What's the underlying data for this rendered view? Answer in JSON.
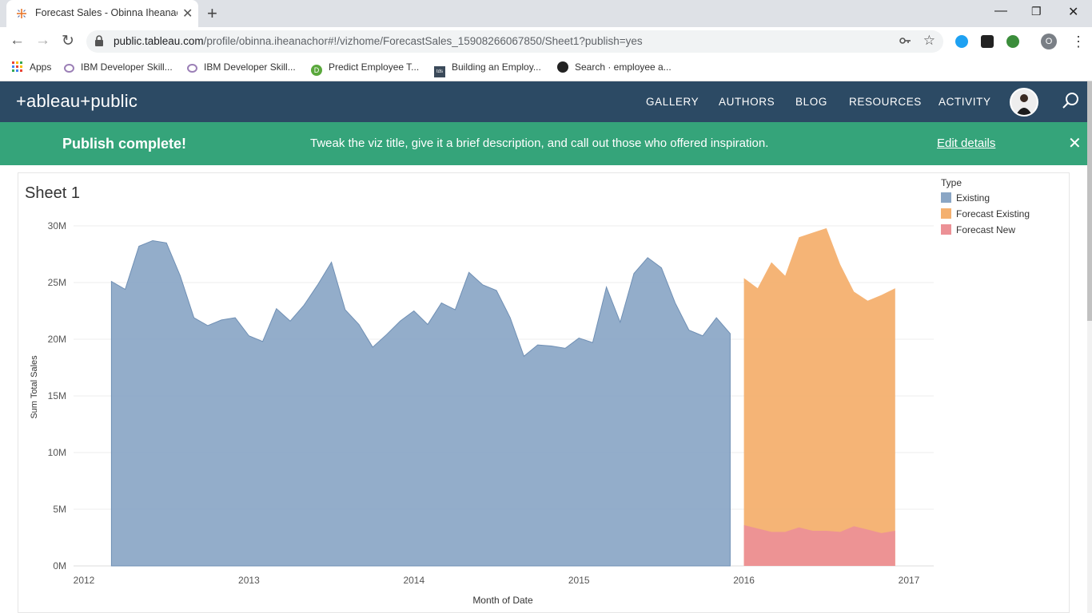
{
  "browser": {
    "tab_title": "Forecast Sales - Obinna Iheanach",
    "url_host": "public.tableau.com",
    "url_path": "/profile/obinna.iheanachor#!/vizhome/ForecastSales_15908266067850/Sheet1?publish=yes",
    "profile_initial": "O"
  },
  "bookmarks": [
    {
      "label": "Apps"
    },
    {
      "label": "IBM Developer Skill..."
    },
    {
      "label": "IBM Developer Skill..."
    },
    {
      "label": "Predict Employee T..."
    },
    {
      "label": "Building an Employ..."
    },
    {
      "label": "Search · employee a..."
    }
  ],
  "header": {
    "logo": "+ableau+public",
    "nav": [
      "GALLERY",
      "AUTHORS",
      "BLOG",
      "RESOURCES",
      "ACTIVITY"
    ]
  },
  "banner": {
    "title": "Publish complete!",
    "message": "Tweak the viz title, give it a brief description, and call out those who offered inspiration.",
    "edit_link": "Edit details"
  },
  "sheet": {
    "title": "Sheet 1"
  },
  "legend": {
    "title": "Type",
    "items": [
      {
        "label": "Existing",
        "color": "#8aa6c5"
      },
      {
        "label": "Forecast Existing",
        "color": "#f4b06f"
      },
      {
        "label": "Forecast New",
        "color": "#ec9196"
      }
    ]
  },
  "chart_data": {
    "type": "area",
    "xlabel": "Month of Date",
    "ylabel": "Sum Total Sales",
    "ylim": [
      0,
      30
    ],
    "y_unit": "M",
    "y_ticks": [
      "0M",
      "5M",
      "10M",
      "15M",
      "20M",
      "25M",
      "30M"
    ],
    "x_ticks": [
      "2012",
      "2013",
      "2014",
      "2015",
      "2016",
      "2017"
    ],
    "grid": true,
    "series": [
      {
        "name": "Existing",
        "color": "#8aa6c5",
        "x": [
          "2012-03",
          "2012-04",
          "2012-05",
          "2012-06",
          "2012-07",
          "2012-08",
          "2012-09",
          "2012-10",
          "2012-11",
          "2012-12",
          "2013-01",
          "2013-02",
          "2013-03",
          "2013-04",
          "2013-05",
          "2013-06",
          "2013-07",
          "2013-08",
          "2013-09",
          "2013-10",
          "2013-11",
          "2013-12",
          "2014-01",
          "2014-02",
          "2014-03",
          "2014-04",
          "2014-05",
          "2014-06",
          "2014-07",
          "2014-08",
          "2014-09",
          "2014-10",
          "2014-11",
          "2014-12",
          "2015-01",
          "2015-02",
          "2015-03",
          "2015-04",
          "2015-05",
          "2015-06",
          "2015-07",
          "2015-08",
          "2015-09",
          "2015-10",
          "2015-11",
          "2015-12"
        ],
        "values": [
          25.1,
          24.4,
          28.2,
          28.7,
          28.5,
          25.6,
          21.9,
          21.2,
          21.7,
          21.9,
          20.3,
          19.8,
          22.7,
          21.6,
          23.0,
          24.8,
          26.8,
          22.6,
          21.3,
          19.3,
          20.4,
          21.6,
          22.5,
          21.3,
          23.2,
          22.6,
          25.9,
          24.8,
          24.3,
          21.9,
          18.5,
          19.5,
          19.4,
          19.2,
          20.1,
          19.7,
          24.6,
          21.5,
          25.8,
          27.2,
          26.3,
          23.2,
          20.8,
          20.3,
          21.9,
          20.5
        ]
      },
      {
        "name": "Forecast Existing",
        "color": "#f4b06f",
        "x": [
          "2016-01",
          "2016-02",
          "2016-03",
          "2016-04",
          "2016-05",
          "2016-06",
          "2016-07",
          "2016-08",
          "2016-09",
          "2016-10",
          "2016-11",
          "2016-12"
        ],
        "values": [
          25.4,
          24.5,
          26.8,
          25.6,
          29.0,
          29.4,
          29.8,
          26.6,
          24.2,
          23.4,
          23.9,
          24.5
        ]
      },
      {
        "name": "Forecast New",
        "color": "#ec9196",
        "x": [
          "2016-01",
          "2016-02",
          "2016-03",
          "2016-04",
          "2016-05",
          "2016-06",
          "2016-07",
          "2016-08",
          "2016-09",
          "2016-10",
          "2016-11",
          "2016-12"
        ],
        "values": [
          3.6,
          3.3,
          3.0,
          3.0,
          3.4,
          3.1,
          3.1,
          3.0,
          3.5,
          3.2,
          2.9,
          3.1
        ]
      }
    ]
  }
}
